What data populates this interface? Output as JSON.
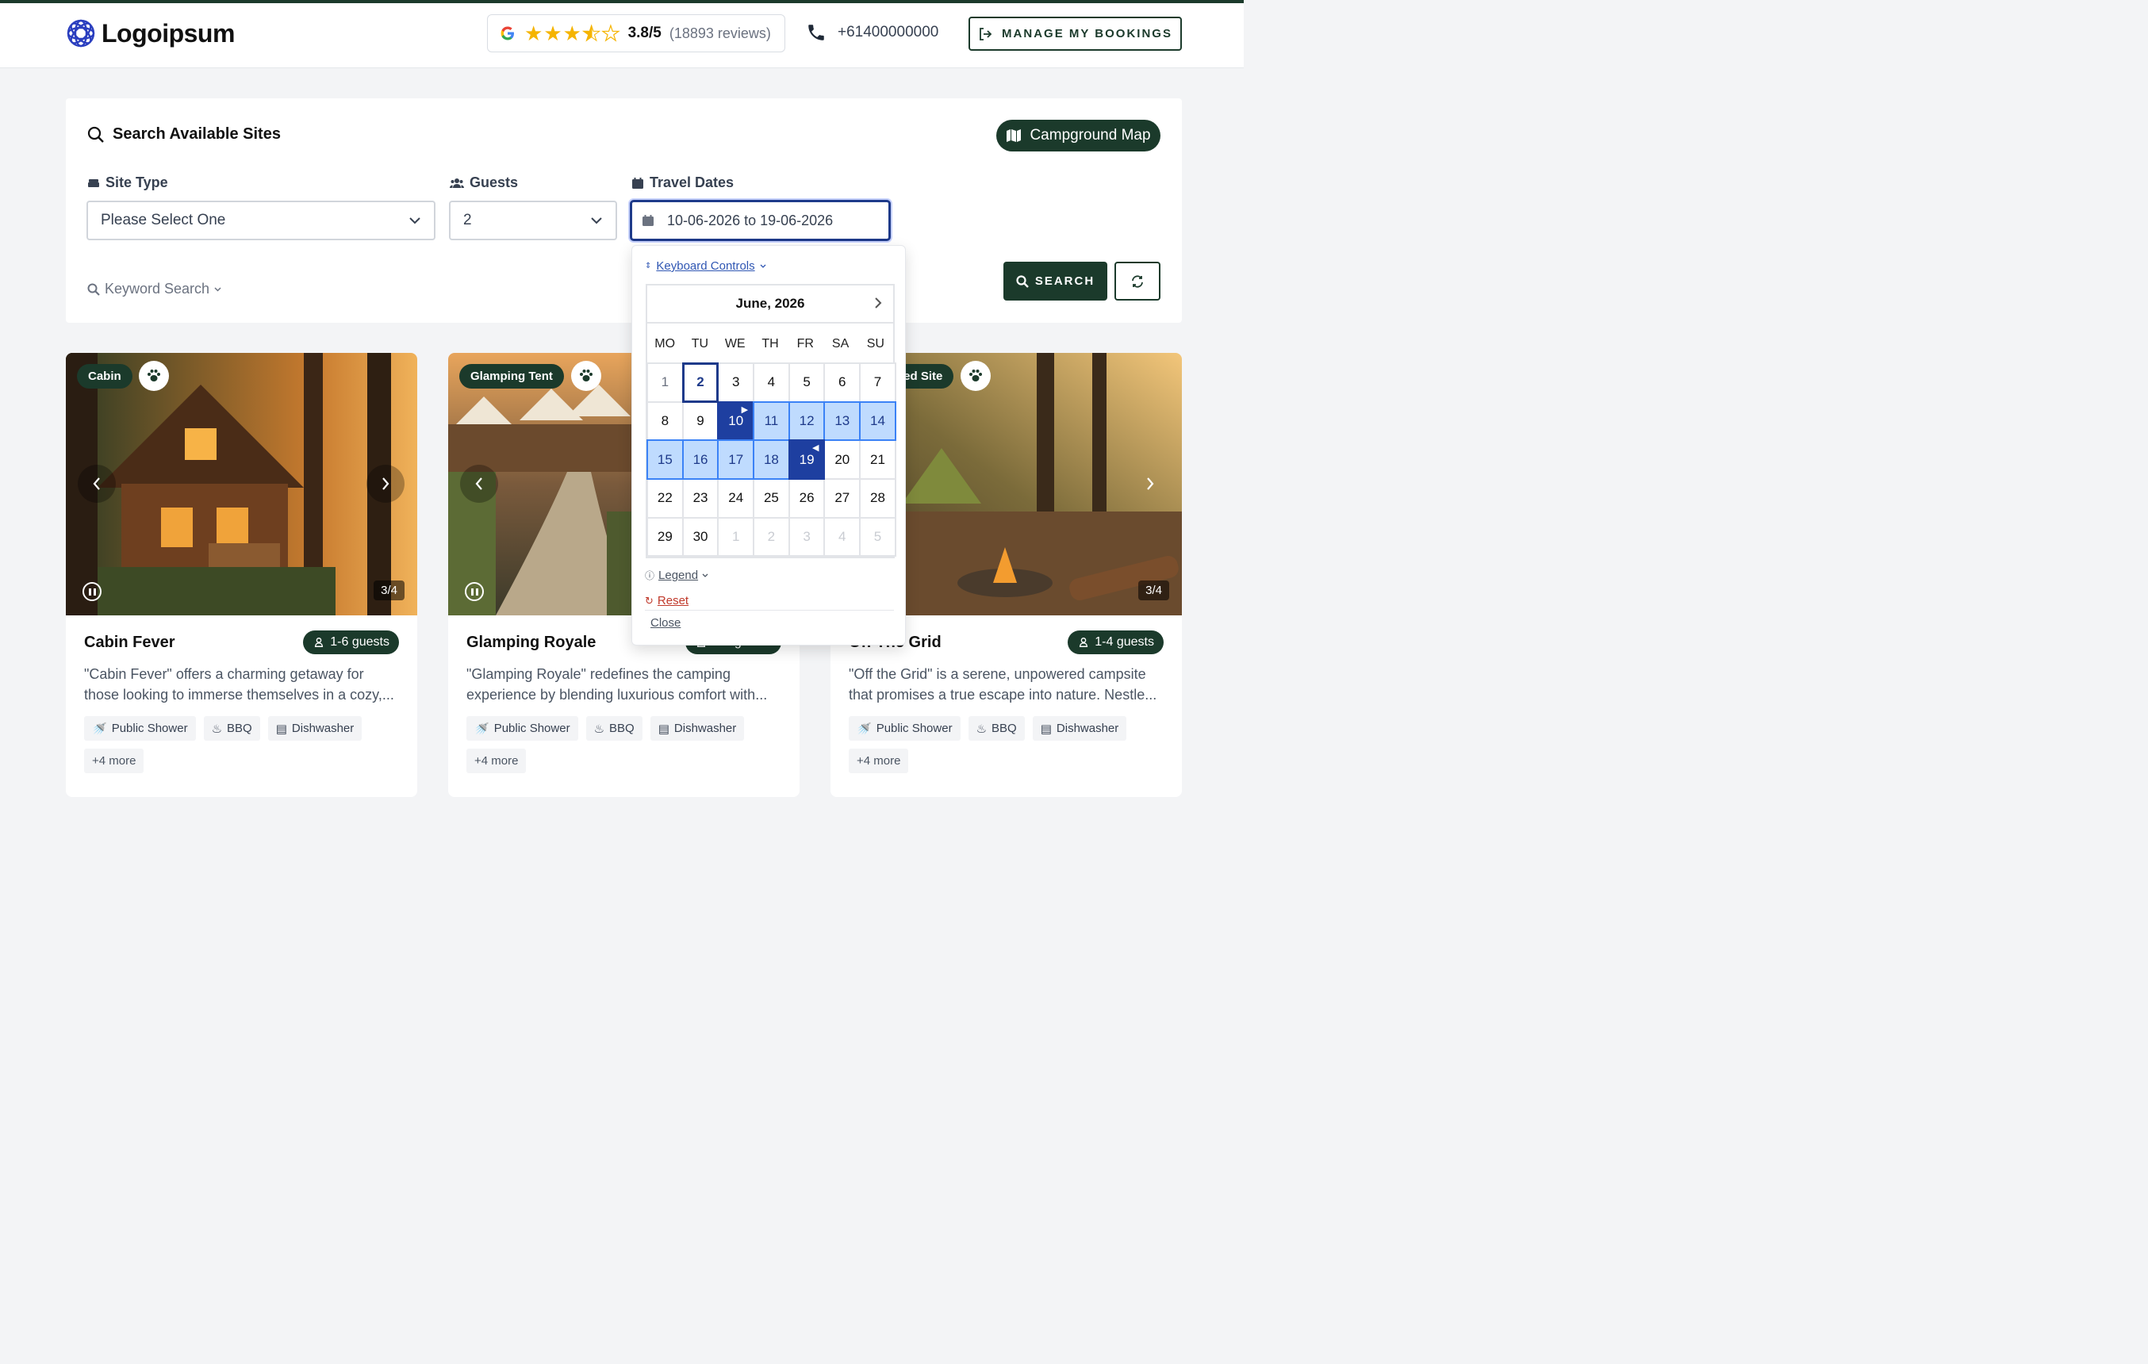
{
  "header": {
    "logo_text": "Logoipsum",
    "rating": {
      "score": "3.8/5",
      "count": "(18893 reviews)",
      "stars": 3.8
    },
    "phone": "+61400000000",
    "manage_label": "MANAGE MY BOOKINGS"
  },
  "search": {
    "title": "Search Available Sites",
    "map_label": "Campground Map",
    "site_type": {
      "label": "Site Type",
      "value": "Please Select One"
    },
    "guests": {
      "label": "Guests",
      "value": "2"
    },
    "dates": {
      "label": "Travel Dates",
      "value": "10-06-2026 to 19-06-2026"
    },
    "keyword_label": "Keyword Search",
    "search_label": "SEARCH"
  },
  "datepicker": {
    "keyboard_label": "Keyboard Controls",
    "month": "June, 2026",
    "weekdays": [
      "MO",
      "TU",
      "WE",
      "TH",
      "FR",
      "SA",
      "SU"
    ],
    "days": [
      [
        "1",
        "2",
        "3",
        "4",
        "5",
        "6",
        "7"
      ],
      [
        "8",
        "9",
        "10",
        "11",
        "12",
        "13",
        "14"
      ],
      [
        "15",
        "16",
        "17",
        "18",
        "19",
        "20",
        "21"
      ],
      [
        "22",
        "23",
        "24",
        "25",
        "26",
        "27",
        "28"
      ],
      [
        "29",
        "30",
        "1",
        "2",
        "3",
        "4",
        "5"
      ]
    ],
    "legend_label": "Legend",
    "reset_label": "Reset",
    "close_label": "Close"
  },
  "cards": [
    {
      "type": "Cabin",
      "title": "Cabin Fever",
      "guests": "1-6 guests",
      "counter": "3/4",
      "desc_1": "\"Cabin Fever\" offers a charming getaway for",
      "desc_2": "those looking to immerse themselves in a cozy,...",
      "amenities": [
        "Public Shower",
        "BBQ",
        "Dishwasher"
      ],
      "more": "+4 more"
    },
    {
      "type": "Glamping Tent",
      "title": "Glamping Royale",
      "guests": "2-4 guests",
      "counter": "",
      "desc_1": "\"Glamping Royale\" redefines the camping",
      "desc_2": "experience by blending luxurious comfort with...",
      "amenities": [
        "Public Shower",
        "BBQ",
        "Dishwasher"
      ],
      "more": "+4 more"
    },
    {
      "type": "Unpowered Site",
      "title": "Off The Grid",
      "guests": "1-4 guests",
      "counter": "3/4",
      "desc_1": "\"Off the Grid\" is a serene, unpowered campsite",
      "desc_2": "that promises a true escape into nature. Nestle...",
      "amenities": [
        "Public Shower",
        "BBQ",
        "Dishwasher"
      ],
      "more": "+4 more"
    }
  ],
  "colors": {
    "brand_green": "#1b3a2b",
    "range_blue": "#bfdbfe",
    "selected_blue": "#1e3fa0",
    "star_gold": "#f5b400"
  }
}
